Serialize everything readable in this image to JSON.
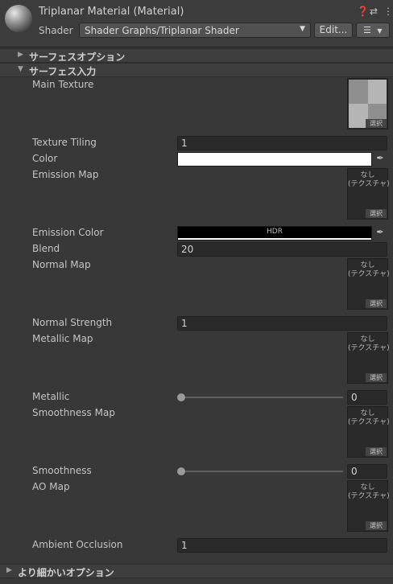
{
  "header": {
    "title": "Triplanar Material (Material)",
    "help_icon": "help-icon",
    "preset_icon": "preset-icon",
    "menu_icon": "kebab-menu-icon",
    "shader_label": "Shader",
    "shader_value": "Shader Graphs/Triplanar Shader",
    "edit_label": "Edit...",
    "list_icon": "list-icon"
  },
  "sections": {
    "surface_options": "サーフェスオプション",
    "surface_inputs": "サーフェス入力",
    "advanced_options": "より細かいオプション"
  },
  "properties": {
    "main_texture": {
      "label": "Main Texture",
      "select": "選択"
    },
    "texture_tiling": {
      "label": "Texture Tiling",
      "value": "1"
    },
    "color": {
      "label": "Color",
      "value_hex": "#ffffff"
    },
    "emission_map": {
      "label": "Emission Map",
      "none": "なし\n(テクスチャ)",
      "select": "選択"
    },
    "emission_color": {
      "label": "Emission Color",
      "badge": "HDR",
      "value_hex": "#000000"
    },
    "blend": {
      "label": "Blend",
      "value": "20"
    },
    "normal_map": {
      "label": "Normal Map",
      "none": "なし\n(テクスチャ)",
      "select": "選択"
    },
    "normal_strength": {
      "label": "Normal Strength",
      "value": "1"
    },
    "metallic_map": {
      "label": "Metallic Map",
      "none": "なし\n(テクスチャ)",
      "select": "選択"
    },
    "metallic": {
      "label": "Metallic",
      "value": "0"
    },
    "smoothness_map": {
      "label": "Smoothness Map",
      "none": "なし\n(テクスチャ)",
      "select": "選択"
    },
    "smoothness": {
      "label": "Smoothness",
      "value": "0"
    },
    "ao_map": {
      "label": "AO Map",
      "none": "なし\n(テクスチャ)",
      "select": "選択"
    },
    "ambient_occlusion": {
      "label": "Ambient Occlusion",
      "value": "1"
    }
  }
}
